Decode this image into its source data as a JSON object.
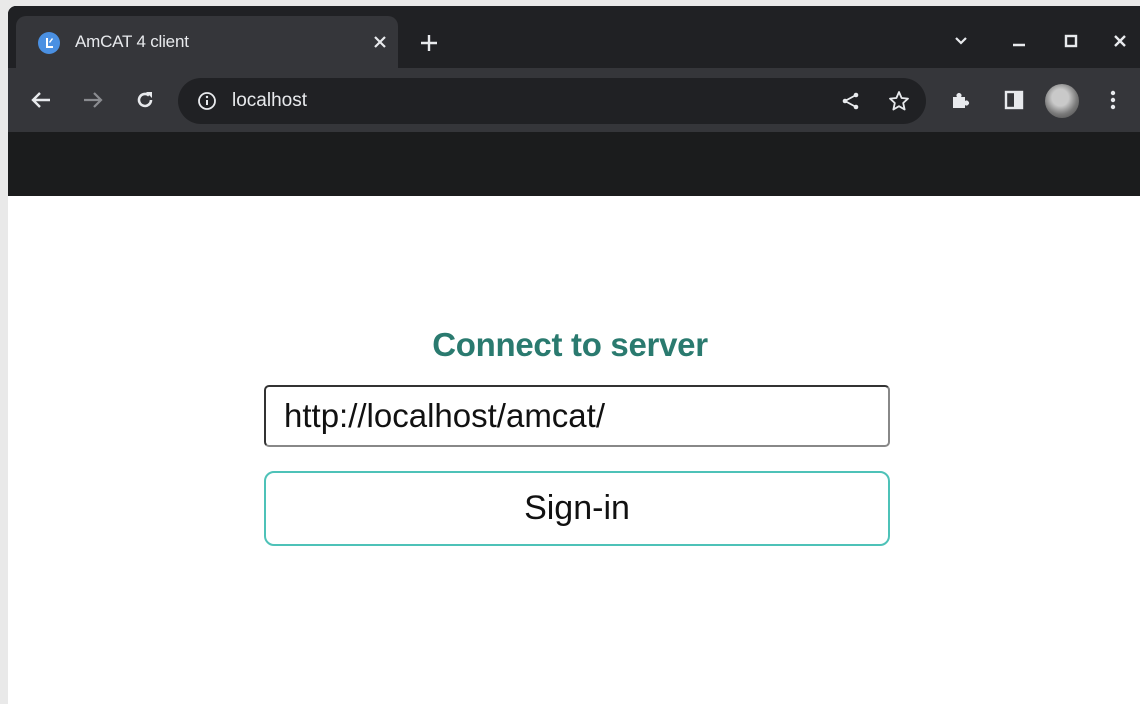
{
  "browser": {
    "tab": {
      "title": "AmCAT 4 client",
      "favicon": "amcat-logo-icon",
      "close_icon": "close-icon"
    },
    "new_tab_icon": "plus-icon",
    "window_controls": [
      "chevron-down-icon",
      "minimize-icon",
      "maximize-icon",
      "close-icon"
    ],
    "toolbar": {
      "back_icon": "arrow-left-icon",
      "forward_icon": "arrow-right-icon",
      "reload_icon": "reload-icon",
      "info_icon": "info-icon",
      "url": "localhost",
      "share_icon": "share-icon",
      "bookmark_icon": "star-icon",
      "extensions_icon": "puzzle-icon",
      "side_panel_icon": "side-panel-icon",
      "profile_icon": "avatar",
      "menu_icon": "kebab-menu-icon"
    }
  },
  "page": {
    "heading": "Connect to server",
    "server_input_value": "http://localhost/amcat/",
    "signin_label": "Sign-in"
  },
  "colors": {
    "heading": "#2a7a6f",
    "signin_border": "#4ec2b8",
    "navbar": "#1b1c1d",
    "chrome_dark": "#202124",
    "chrome_toolbar": "#35363a"
  }
}
